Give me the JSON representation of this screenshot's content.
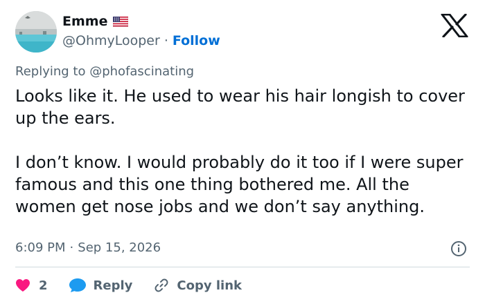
{
  "author": {
    "display_name": "Emme",
    "handle": "@OhmyLooper",
    "flag_icon": "us-flag-icon",
    "follow_label": "Follow",
    "separator": "·"
  },
  "reply": {
    "prefix": "Replying to",
    "mention": "@phofascinating"
  },
  "post": {
    "paragraphs": [
      "Looks like it. He used to wear his hair longish to cover up the ears.",
      "I don’t know. I would probably do it too if I were super famous and this one thing bothered me. All the women get nose jobs and we don’t say anything."
    ],
    "time": "6:09 PM",
    "date": "Sep 15, 2026",
    "meta_separator": "·"
  },
  "actions": {
    "like_count": "2",
    "reply_label": "Reply",
    "copy_label": "Copy link"
  },
  "colors": {
    "like": "#f91880",
    "reply": "#1d9bf0",
    "link": "#006fd6",
    "muted": "#536471",
    "text": "#0f1419"
  }
}
